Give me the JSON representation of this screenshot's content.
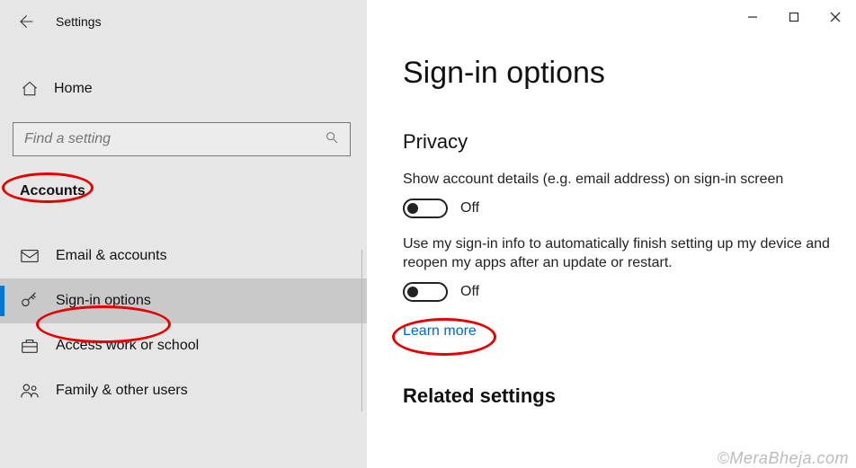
{
  "titlebar": {
    "title": "Settings"
  },
  "sidebar": {
    "home": "Home",
    "search_placeholder": "Find a setting",
    "section": "Accounts",
    "items": [
      {
        "label": "Email & accounts"
      },
      {
        "label": "Sign-in options"
      },
      {
        "label": "Access work or school"
      },
      {
        "label": "Family & other users"
      }
    ]
  },
  "page": {
    "title": "Sign-in options",
    "privacy_heading": "Privacy",
    "setting1_text": "Show account details (e.g. email address) on sign-in screen",
    "toggle1_state": "Off",
    "setting2_text": "Use my sign-in info to automatically finish setting up my device and reopen my apps after an update or restart.",
    "toggle2_state": "Off",
    "learn_more": "Learn more",
    "related_heading": "Related settings"
  },
  "watermark": "©MeraBheja.com"
}
